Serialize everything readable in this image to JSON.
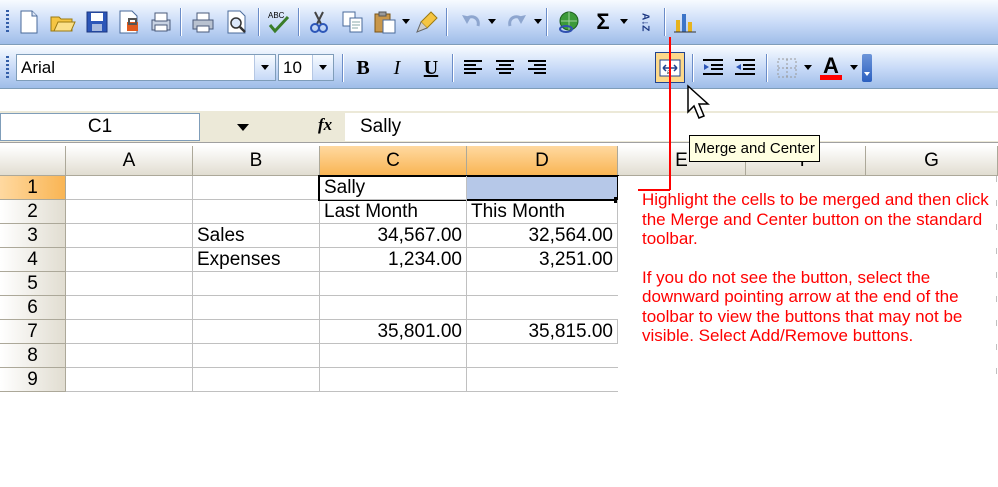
{
  "toolbar_standard": {
    "icons": [
      "new-icon",
      "open-icon",
      "save-icon",
      "permission-icon",
      "print-preview-lock-icon",
      "print-icon",
      "print-preview-icon",
      "spelling-icon",
      "cut-icon",
      "copy-icon",
      "paste-icon",
      "format-painter-icon",
      "undo-icon",
      "redo-icon",
      "hyperlink-icon",
      "autosum-icon",
      "sort-ascending-icon",
      "chart-wizard-icon"
    ],
    "autosum_symbol": "Σ",
    "spelling_label": "ABC",
    "sort_label": "A↓Z"
  },
  "toolbar_formatting": {
    "font_name": "Arial",
    "font_size": "10",
    "bold_label": "B",
    "italic_label": "I",
    "underline_label": "U",
    "font_color_label": "A"
  },
  "formula_bar": {
    "name_box": "C1",
    "fx_label": "fx",
    "value": "Sally"
  },
  "columns": [
    "A",
    "B",
    "C",
    "D",
    "E",
    "F",
    "G"
  ],
  "rows": [
    "1",
    "2",
    "3",
    "4",
    "5",
    "6",
    "7",
    "8",
    "9"
  ],
  "cells": {
    "C1": "Sally",
    "C2": "Last Month",
    "D2": "This Month",
    "B3": "Sales",
    "C3": "34,567.00",
    "D3": "32,564.00",
    "B4": "Expenses",
    "C4": "1,234.00",
    "D4": "3,251.00",
    "C7": "35,801.00",
    "D7": "35,815.00"
  },
  "tooltip": "Merge and Center",
  "callout": {
    "para1": "Highlight the cells to be merged and then click the Merge and Center button on the standard toolbar.",
    "para2": "If you do not see the button, select the downward pointing arrow at the end of the toolbar to view the buttons that may not be visible. Select Add/Remove buttons."
  },
  "colors": {
    "callout": "#ff0000",
    "selection_fill": "#b6c8e8",
    "header_selected": "#f9b554"
  }
}
